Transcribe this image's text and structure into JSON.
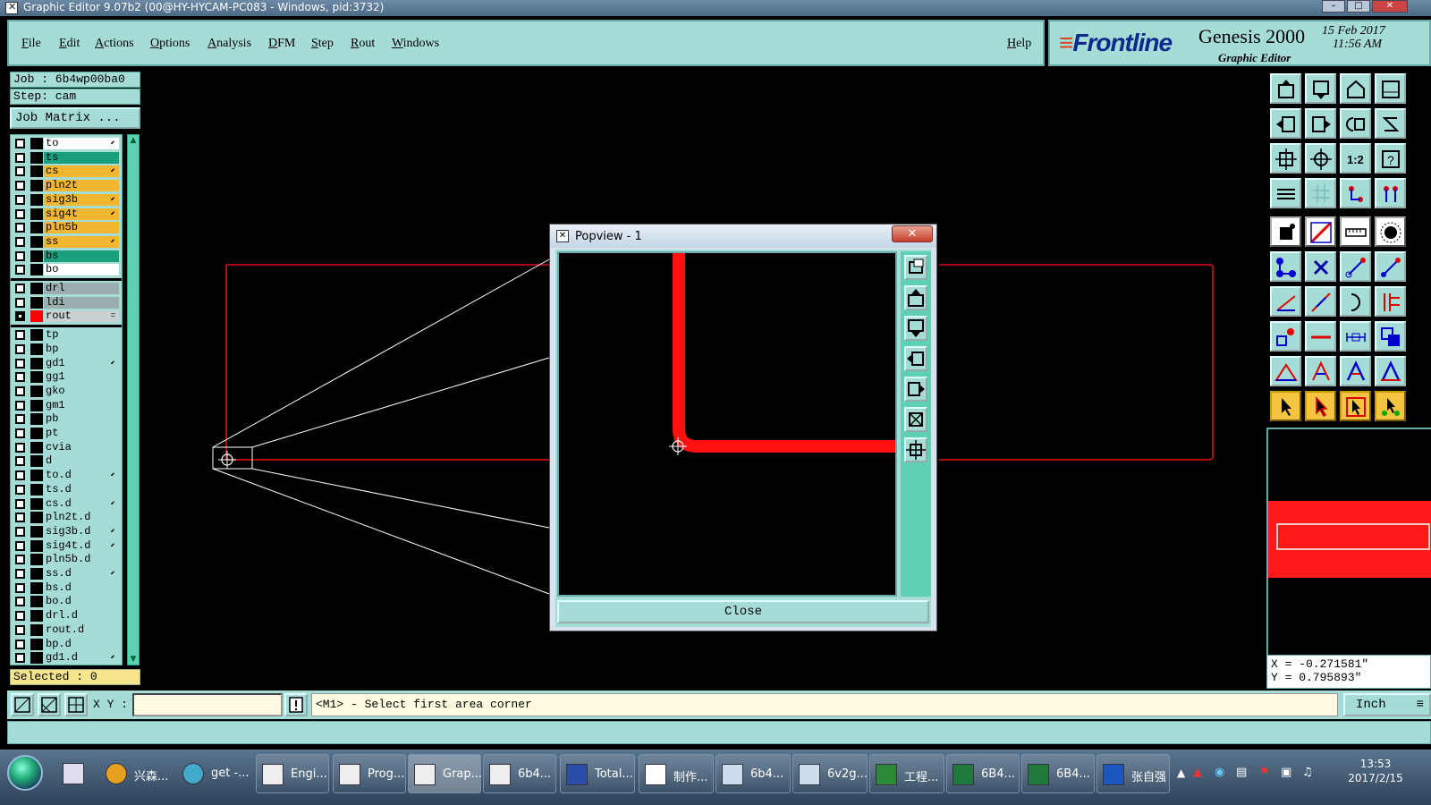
{
  "window": {
    "title": "Graphic Editor 9.07b2 (00@HY-HYCAM-PC083 - Windows, pid:3732)"
  },
  "menu": {
    "items": [
      "File",
      "Edit",
      "Actions",
      "Options",
      "Analysis",
      "DFM",
      "Step",
      "Rout",
      "Windows"
    ],
    "help": "Help"
  },
  "brand": {
    "logo": "Frontline",
    "product": "Genesis 2000",
    "subtitle": "Graphic Editor",
    "date": "15 Feb 2017",
    "time": "11:56 AM"
  },
  "job": {
    "job_label": "Job : 6b4wp00ba0",
    "step_label": "Step: cam",
    "job_matrix": "Job Matrix ..."
  },
  "layers": [
    {
      "name": "to",
      "color": "#ffffff",
      "mark": "⬋"
    },
    {
      "name": "ts",
      "color": "#1aa07a",
      "mark": ""
    },
    {
      "name": "cs",
      "color": "#f2b630",
      "mark": "⬋"
    },
    {
      "name": "pln2t",
      "color": "#f2b630",
      "mark": ""
    },
    {
      "name": "sig3b",
      "color": "#f2b630",
      "mark": "⬋"
    },
    {
      "name": "sig4t",
      "color": "#f2b630",
      "mark": "⬋"
    },
    {
      "name": "pln5b",
      "color": "#f2b630",
      "mark": ""
    },
    {
      "name": "ss",
      "color": "#f2b630",
      "mark": "⬋"
    },
    {
      "name": "bs",
      "color": "#1aa07a",
      "mark": ""
    },
    {
      "name": "bo",
      "color": "#ffffff",
      "mark": ""
    },
    {
      "name": "drl",
      "color": "#9aaeb0",
      "mark": "",
      "group_start": true
    },
    {
      "name": "ldi",
      "color": "#9aaeb0",
      "mark": ""
    },
    {
      "name": "rout",
      "color": "#c8d2d2",
      "mark": "=",
      "active": true
    },
    {
      "name": "tp",
      "color": "#a6dcd6",
      "mark": "",
      "group_start": true
    },
    {
      "name": "bp",
      "color": "#a6dcd6",
      "mark": ""
    },
    {
      "name": "gd1",
      "color": "#a6dcd6",
      "mark": "⬋"
    },
    {
      "name": "gg1",
      "color": "#a6dcd6",
      "mark": ""
    },
    {
      "name": "gko",
      "color": "#a6dcd6",
      "mark": ""
    },
    {
      "name": "gm1",
      "color": "#a6dcd6",
      "mark": ""
    },
    {
      "name": "pb",
      "color": "#a6dcd6",
      "mark": ""
    },
    {
      "name": "pt",
      "color": "#a6dcd6",
      "mark": ""
    },
    {
      "name": "cvia",
      "color": "#a6dcd6",
      "mark": ""
    },
    {
      "name": "d",
      "color": "#a6dcd6",
      "mark": ""
    },
    {
      "name": "to.d",
      "color": "#a6dcd6",
      "mark": "⬋"
    },
    {
      "name": "ts.d",
      "color": "#a6dcd6",
      "mark": ""
    },
    {
      "name": "cs.d",
      "color": "#a6dcd6",
      "mark": "⬋"
    },
    {
      "name": "pln2t.d",
      "color": "#a6dcd6",
      "mark": ""
    },
    {
      "name": "sig3b.d",
      "color": "#a6dcd6",
      "mark": "⬋"
    },
    {
      "name": "sig4t.d",
      "color": "#a6dcd6",
      "mark": "⬋"
    },
    {
      "name": "pln5b.d",
      "color": "#a6dcd6",
      "mark": ""
    },
    {
      "name": "ss.d",
      "color": "#a6dcd6",
      "mark": "⬋"
    },
    {
      "name": "bs.d",
      "color": "#a6dcd6",
      "mark": ""
    },
    {
      "name": "bo.d",
      "color": "#a6dcd6",
      "mark": ""
    },
    {
      "name": "drl.d",
      "color": "#a6dcd6",
      "mark": ""
    },
    {
      "name": "rout.d",
      "color": "#a6dcd6",
      "mark": ""
    },
    {
      "name": "bp.d",
      "color": "#a6dcd6",
      "mark": ""
    },
    {
      "name": "gd1.d",
      "color": "#a6dcd6",
      "mark": "⬋"
    }
  ],
  "selected_label": "Selected : 0",
  "popview": {
    "title": "Popview - 1",
    "close_x": "✕",
    "close_label": "Close"
  },
  "coords": {
    "x": "X = -0.271581\"",
    "y": "Y = 0.795893\""
  },
  "status": {
    "xy_label": "X Y :",
    "xy_value": "",
    "message": "<M1> - Select first area corner",
    "units": "Inch"
  },
  "taskbar": {
    "pinned": [
      {
        "label": "兴森..."
      },
      {
        "label": "get -..."
      }
    ],
    "tasks": [
      {
        "label": "Engi..."
      },
      {
        "label": "Prog..."
      },
      {
        "label": "Grap..."
      },
      {
        "label": "6b4..."
      },
      {
        "label": "Total..."
      },
      {
        "label": "制作..."
      },
      {
        "label": "6b4..."
      },
      {
        "label": "6v2g..."
      },
      {
        "label": "工程..."
      },
      {
        "label": "6B4..."
      },
      {
        "label": "6B4..."
      },
      {
        "label": "张自强"
      }
    ],
    "clock_time": "13:53",
    "clock_date": "2017/2/15"
  },
  "colors": {
    "panel": "#a6dcd6",
    "panel_dark": "#5fd1b3",
    "rout": "#ff0000",
    "canvas": "#000000"
  }
}
